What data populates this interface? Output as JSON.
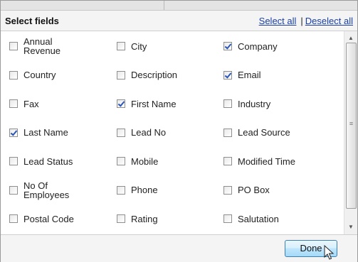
{
  "header": {
    "title": "Select fields",
    "select_all": "Select all",
    "separator": "|",
    "deselect_all": "Deselect all"
  },
  "fields": [
    {
      "label": "Annual\nRevenue",
      "checked": false
    },
    {
      "label": "City",
      "checked": false
    },
    {
      "label": "Company",
      "checked": true
    },
    {
      "label": "Country",
      "checked": false
    },
    {
      "label": "Description",
      "checked": false
    },
    {
      "label": "Email",
      "checked": true
    },
    {
      "label": "Fax",
      "checked": false
    },
    {
      "label": "First Name",
      "checked": true
    },
    {
      "label": "Industry",
      "checked": false
    },
    {
      "label": "Last Name",
      "checked": true
    },
    {
      "label": "Lead No",
      "checked": false
    },
    {
      "label": "Lead Source",
      "checked": false
    },
    {
      "label": "Lead Status",
      "checked": false
    },
    {
      "label": "Mobile",
      "checked": false
    },
    {
      "label": "Modified Time",
      "checked": false
    },
    {
      "label": "No Of\nEmployees",
      "checked": false
    },
    {
      "label": "Phone",
      "checked": false
    },
    {
      "label": "PO Box",
      "checked": false
    },
    {
      "label": "Postal Code",
      "checked": false
    },
    {
      "label": "Rating",
      "checked": false
    },
    {
      "label": "Salutation",
      "checked": false
    }
  ],
  "footer": {
    "done_label": "Done"
  },
  "icons": {
    "scroll_up": "scroll-up-arrow-icon",
    "scroll_down": "scroll-down-arrow-icon",
    "cursor": "mouse-pointer-icon"
  },
  "colors": {
    "link": "#1a3fa5",
    "checkmark": "#2a55b8",
    "button_border": "#3c7fb1"
  }
}
